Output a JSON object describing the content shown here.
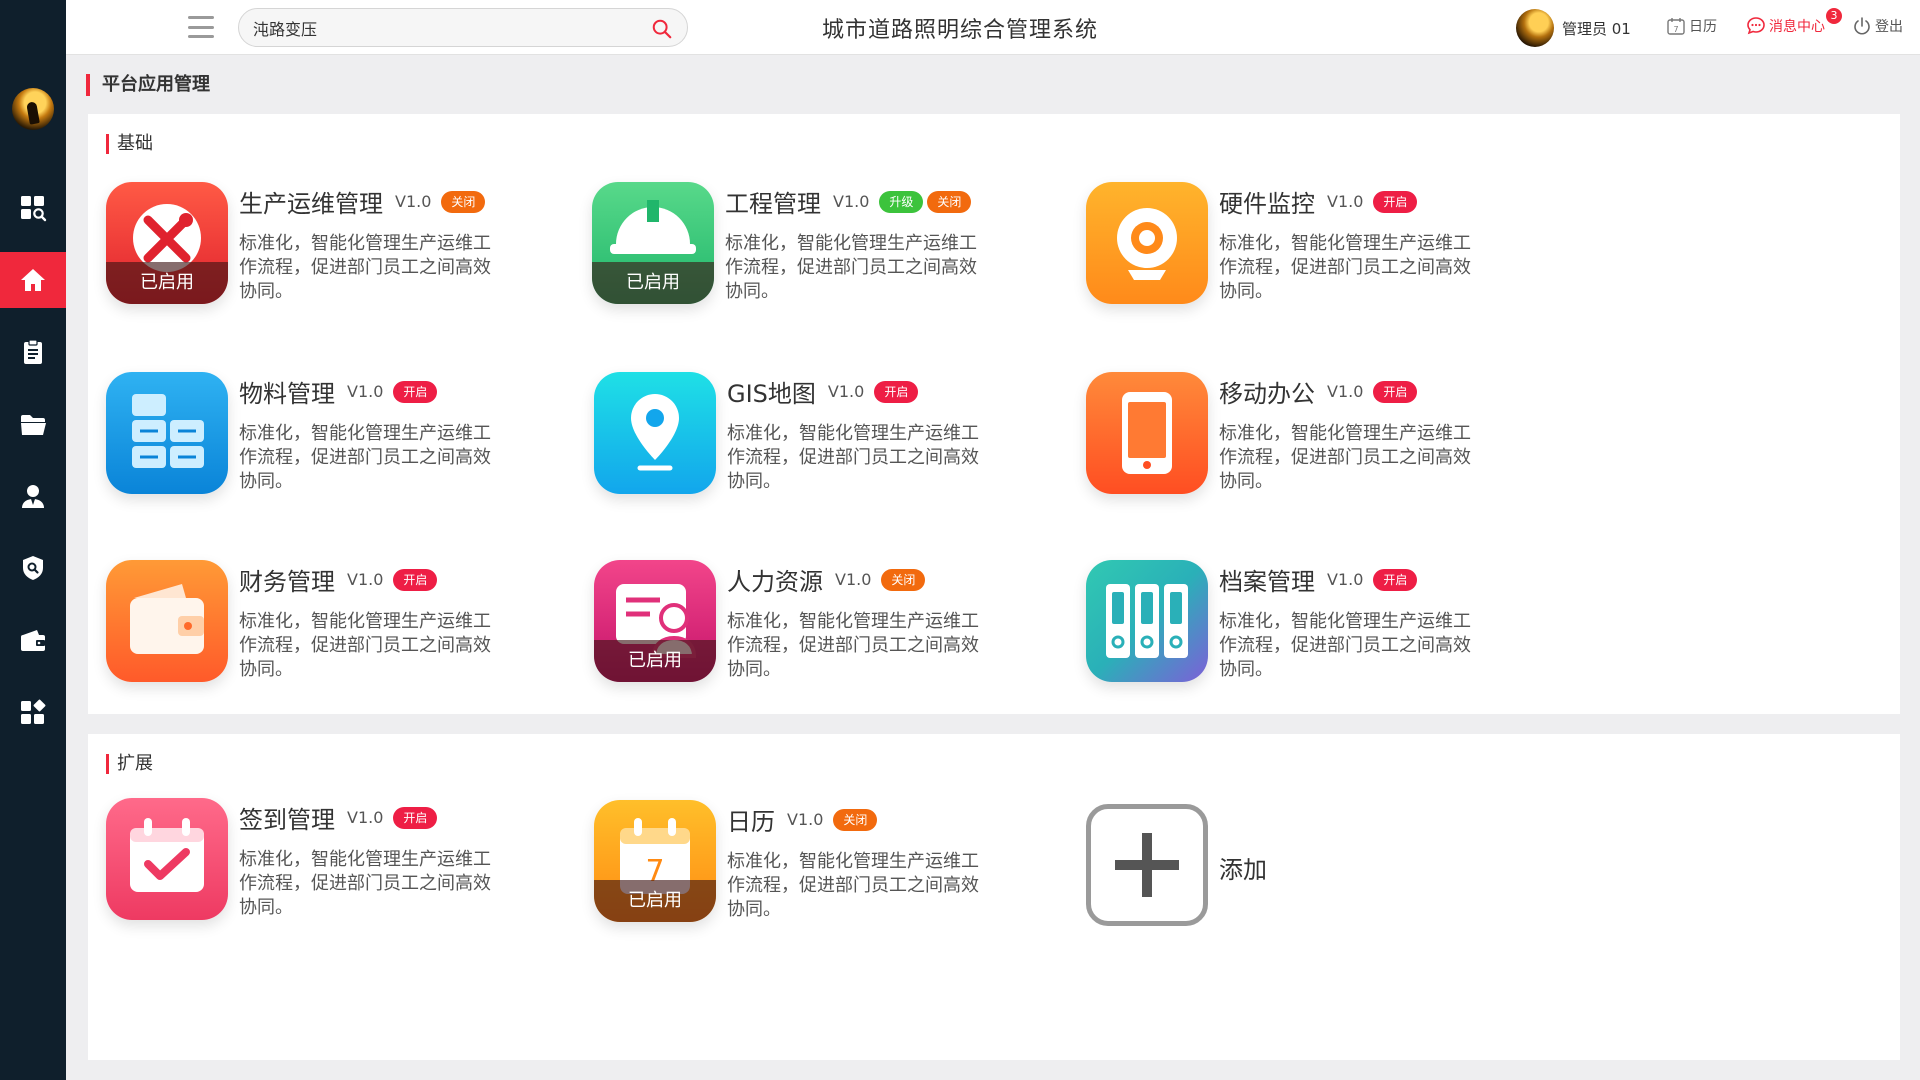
{
  "header": {
    "title": "城市道路照明综合管理系统",
    "search_value": "沌路变压",
    "user_name": "管理员 01",
    "calendar_label": "日历",
    "messages_label": "消息中心",
    "messages_count": "3",
    "logout_label": "登出"
  },
  "sidebar": {
    "items": [
      {
        "icon": "dashboard-search-icon"
      },
      {
        "icon": "home-icon",
        "active": true
      },
      {
        "icon": "clipboard-icon"
      },
      {
        "icon": "folder-icon"
      },
      {
        "icon": "user-icon"
      },
      {
        "icon": "shield-icon"
      },
      {
        "icon": "wallet-icon"
      },
      {
        "icon": "apps-icon"
      }
    ]
  },
  "page": {
    "title": "平台应用管理"
  },
  "sections": {
    "basic_label": "基础",
    "ext_label": "扩展"
  },
  "apps": [
    {
      "name": "生产运维管理",
      "version": "V1.0",
      "tags": [
        "关闭"
      ],
      "enabled_label": "已启用",
      "desc": "标准化，智能化管理生产运维工作流程，促进部门员工之间高效协同。"
    },
    {
      "name": "工程管理",
      "version": "V1.0",
      "tags": [
        "升级",
        "关闭"
      ],
      "enabled_label": "已启用",
      "desc": "标准化，智能化管理生产运维工作流程，促进部门员工之间高效协同。"
    },
    {
      "name": "硬件监控",
      "version": "V1.0",
      "tags": [
        "开启"
      ],
      "desc": "标准化，智能化管理生产运维工作流程，促进部门员工之间高效协同。"
    },
    {
      "name": "物料管理",
      "version": "V1.0",
      "tags": [
        "开启"
      ],
      "desc": "标准化，智能化管理生产运维工作流程，促进部门员工之间高效协同。"
    },
    {
      "name": "GIS地图",
      "version": "V1.0",
      "tags": [
        "开启"
      ],
      "desc": "标准化，智能化管理生产运维工作流程，促进部门员工之间高效协同。"
    },
    {
      "name": "移动办公",
      "version": "V1.0",
      "tags": [
        "开启"
      ],
      "desc": "标准化，智能化管理生产运维工作流程，促进部门员工之间高效协同。"
    },
    {
      "name": "财务管理",
      "version": "V1.0",
      "tags": [
        "开启"
      ],
      "desc": "标准化，智能化管理生产运维工作流程，促进部门员工之间高效协同。"
    },
    {
      "name": "人力资源",
      "version": "V1.0",
      "tags": [
        "关闭"
      ],
      "enabled_label": "已启用",
      "desc": "标准化，智能化管理生产运维工作流程，促进部门员工之间高效协同。"
    },
    {
      "name": "档案管理",
      "version": "V1.0",
      "tags": [
        "开启"
      ],
      "desc": "标准化，智能化管理生产运维工作流程，促进部门员工之间高效协同。"
    },
    {
      "name": "签到管理",
      "version": "V1.0",
      "tags": [
        "开启"
      ],
      "desc": "标准化，智能化管理生产运维工作流程，促进部门员工之间高效协同。"
    },
    {
      "name": "日历",
      "version": "V1.0",
      "tags": [
        "关闭"
      ],
      "enabled_label": "已启用",
      "icon_text": "7",
      "desc": "标准化，智能化管理生产运维工作流程，促进部门员工之间高效协同。"
    }
  ],
  "add": {
    "label": "添加"
  },
  "colors": {
    "accent": "#f0283c",
    "sidebar": "#0f1f2c",
    "tag_off": "#f26a0e",
    "tag_on": "#ee1e45",
    "tag_up": "#3cc33c"
  }
}
